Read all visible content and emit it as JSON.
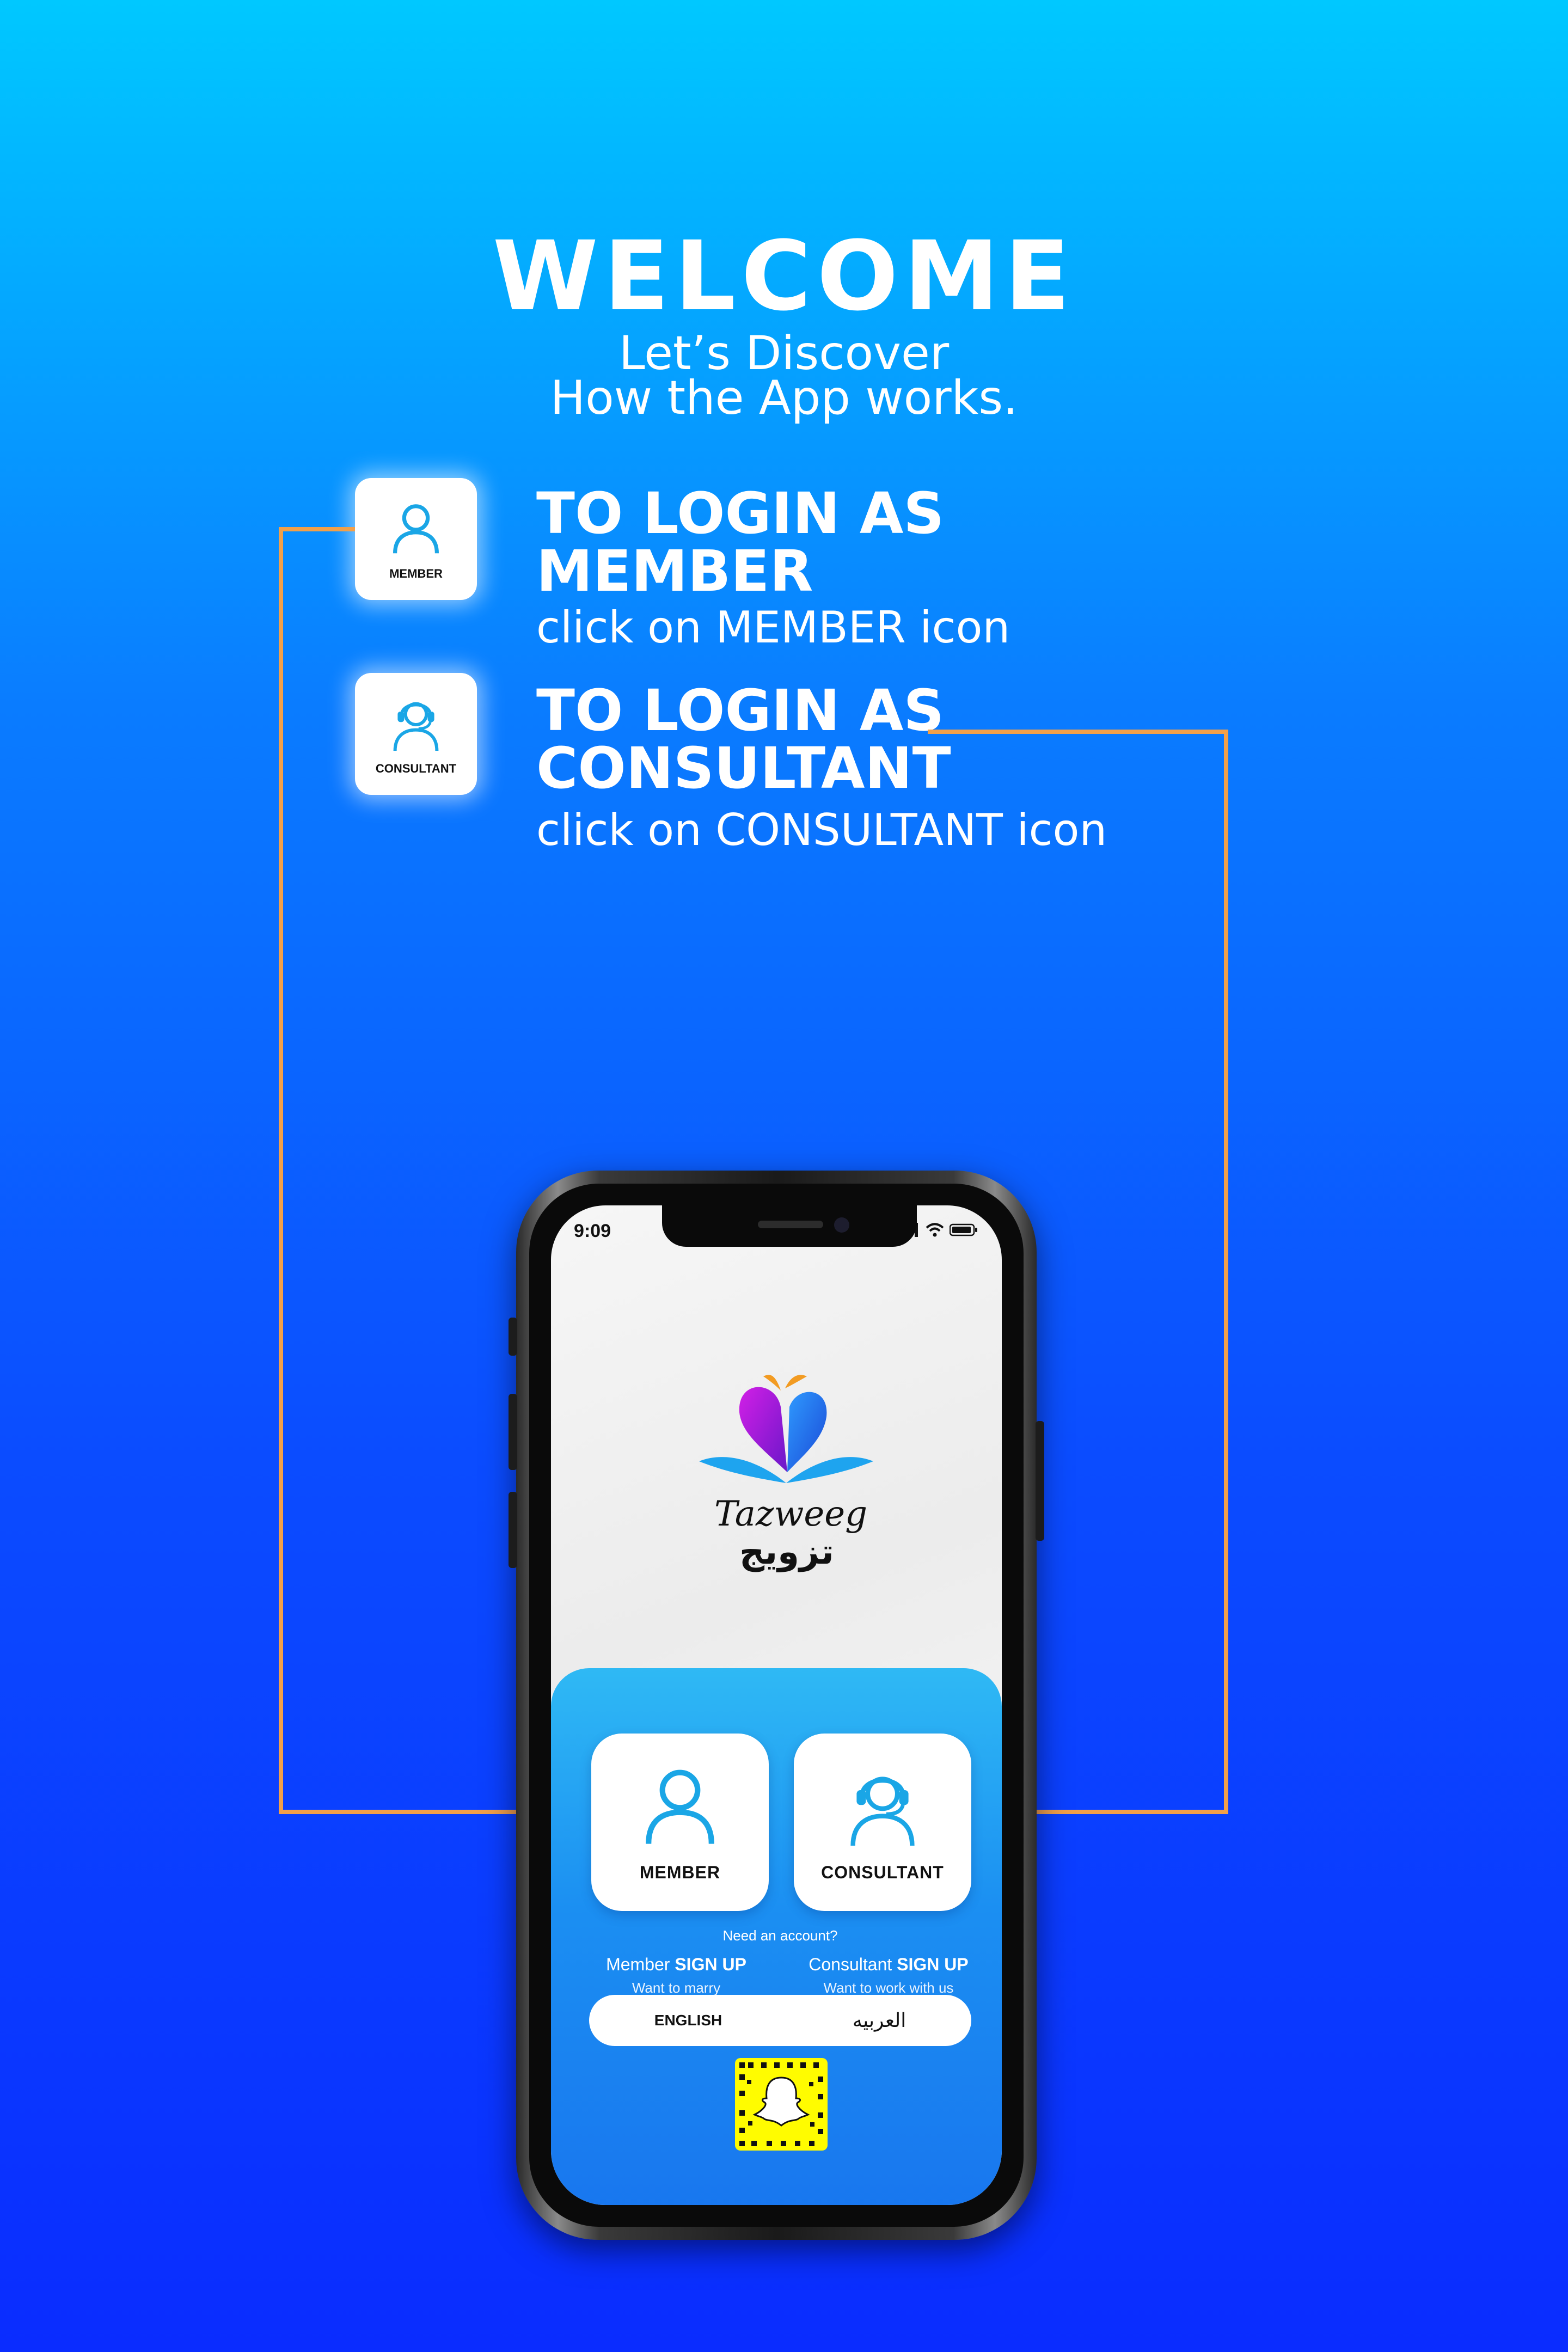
{
  "header": {
    "welcome": "WELCOME",
    "subtitle_line1": "Let’s Discover",
    "subtitle_line2": "How the App works."
  },
  "instructions": {
    "member": {
      "tile_label": "MEMBER",
      "title_line1": "TO LOGIN AS",
      "title_line2": "MEMBER",
      "subtitle": "click on MEMBER icon",
      "icon": "person-icon"
    },
    "consultant": {
      "tile_label": "CONSULTANT",
      "title_line1": "TO LOGIN AS",
      "title_line2": "CONSULTANT",
      "subtitle": "click on CONSULTANT icon",
      "icon": "headset-person-icon"
    }
  },
  "phone": {
    "status_time": "9:09",
    "logo": {
      "name_en": "Tazweeg",
      "name_ar": "تزويج"
    },
    "roles": {
      "member_label": "MEMBER",
      "consultant_label": "CONSULTANT"
    },
    "need_account": "Need an account?",
    "member_signup": {
      "prefix": "Member",
      "action": "SIGN UP",
      "sub": "Want to marry"
    },
    "consultant_signup": {
      "prefix": "Consultant",
      "action": "SIGN UP",
      "sub": "Want to work with us"
    },
    "language": {
      "english": "ENGLISH",
      "arabic": "العربيه"
    },
    "snapcode_icon": "snapchat-ghost-icon"
  },
  "colors": {
    "accent_orange": "#f2a04a",
    "icon_blue": "#1aa6e6",
    "bg_top": "#00c8ff",
    "bg_bottom": "#0a2cff"
  }
}
